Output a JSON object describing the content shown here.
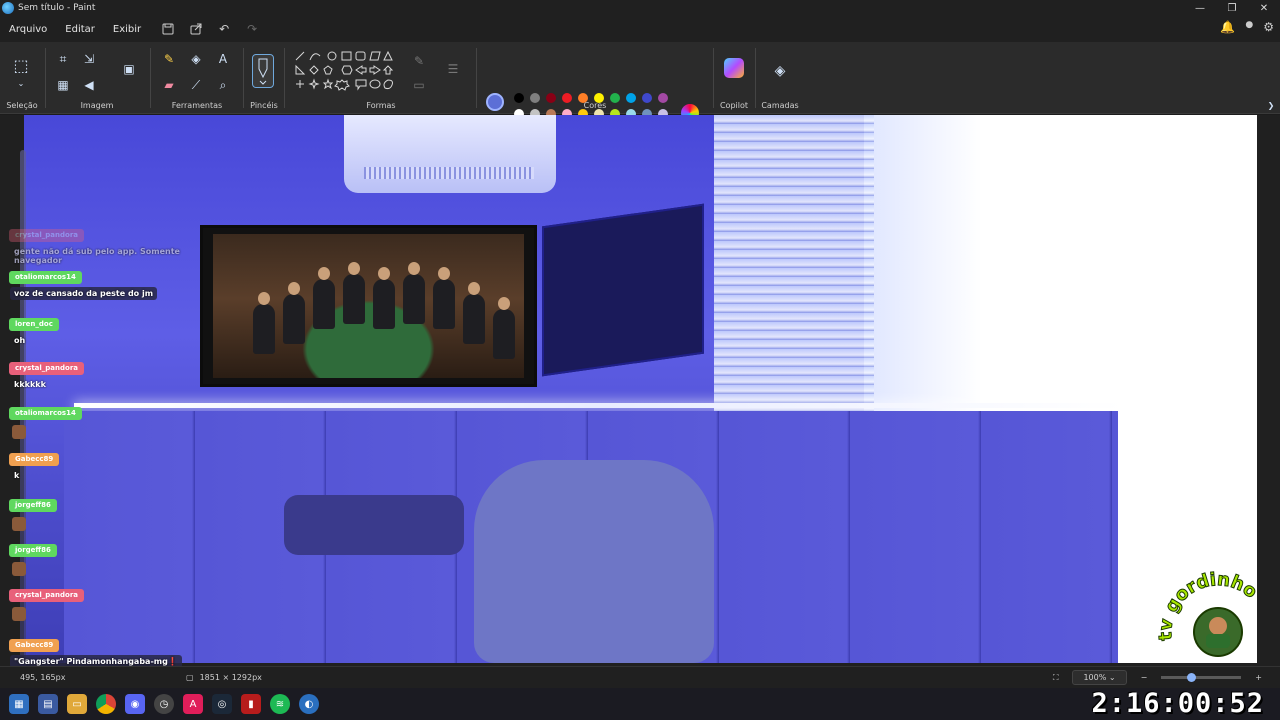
{
  "window": {
    "title": "Sem título - Paint",
    "minimize": "—",
    "maximize": "❐",
    "close": "✕"
  },
  "menu": {
    "items": [
      "Arquivo",
      "Editar",
      "Exibir"
    ],
    "save_icon": "save-icon",
    "share_icon": "share-icon",
    "undo": "↶",
    "redo": "↷"
  },
  "ribbon": {
    "groups": {
      "selecao": "Seleção",
      "imagem": "Imagem",
      "ferramentas": "Ferramentas",
      "pinceis": "Pincéis",
      "formas": "Formas",
      "cores": "Cores",
      "copilot": "Copilot",
      "camadas": "Camadas"
    },
    "primary_color": "#5c6fd6",
    "secondary_color": "#ffffff",
    "palette_row1": [
      "#000000",
      "#7f7f7f",
      "#880015",
      "#ed1c24",
      "#ff7f27",
      "#fff200",
      "#22b14c",
      "#00a2e8",
      "#3f48cc",
      "#a349a4"
    ],
    "palette_row2": [
      "#ffffff",
      "#c3c3c3",
      "#b97a57",
      "#ffaec9",
      "#ffc90e",
      "#efe4b0",
      "#b5e61d",
      "#99d9ea",
      "#7092be",
      "#c8bfe7"
    ]
  },
  "chat": {
    "top_user": "crystal_pandora",
    "top_message": "gente não dá sub pelo app. Somente navegador",
    "lines": [
      {
        "user": "otaliomarcos14",
        "color": "#5fd85f",
        "message": "voz de cansado da peste do jm",
        "boxed": true
      },
      {
        "user": "loren_doc",
        "color": "#5fd85f",
        "message": "oh",
        "boxed": false
      },
      {
        "user": "crystal_pandora",
        "color": "#e8607a",
        "message": "kkkkkk",
        "boxed": false
      },
      {
        "user": "otaliomarcos14",
        "color": "#5fd85f",
        "message": "",
        "boxed": false
      },
      {
        "user": "Gabecc89",
        "color": "#f0a050",
        "message": "k",
        "boxed": false
      },
      {
        "user": "jorgeff86",
        "color": "#5fd85f",
        "message": "",
        "boxed": false
      },
      {
        "user": "jorgeff86",
        "color": "#5fd85f",
        "message": "",
        "boxed": false
      },
      {
        "user": "crystal_pandora",
        "color": "#e8607a",
        "message": "",
        "boxed": false
      },
      {
        "user": "Gabecc89",
        "color": "#f0a050",
        "message": "\"Gangster\" Pindamonhangaba-mg❗",
        "boxed": true
      },
      {
        "user": "otaliomarcos14",
        "color": "#5fd85f",
        "message": "",
        "boxed": false
      }
    ]
  },
  "status": {
    "cursor": "495, 165px",
    "canvas_size": "1851 × 1292px",
    "zoom": "100%"
  },
  "clock": "2:16:00:52",
  "logo": {
    "text_top": "tv gordinho",
    "text_bottom": "gordinho tv"
  }
}
